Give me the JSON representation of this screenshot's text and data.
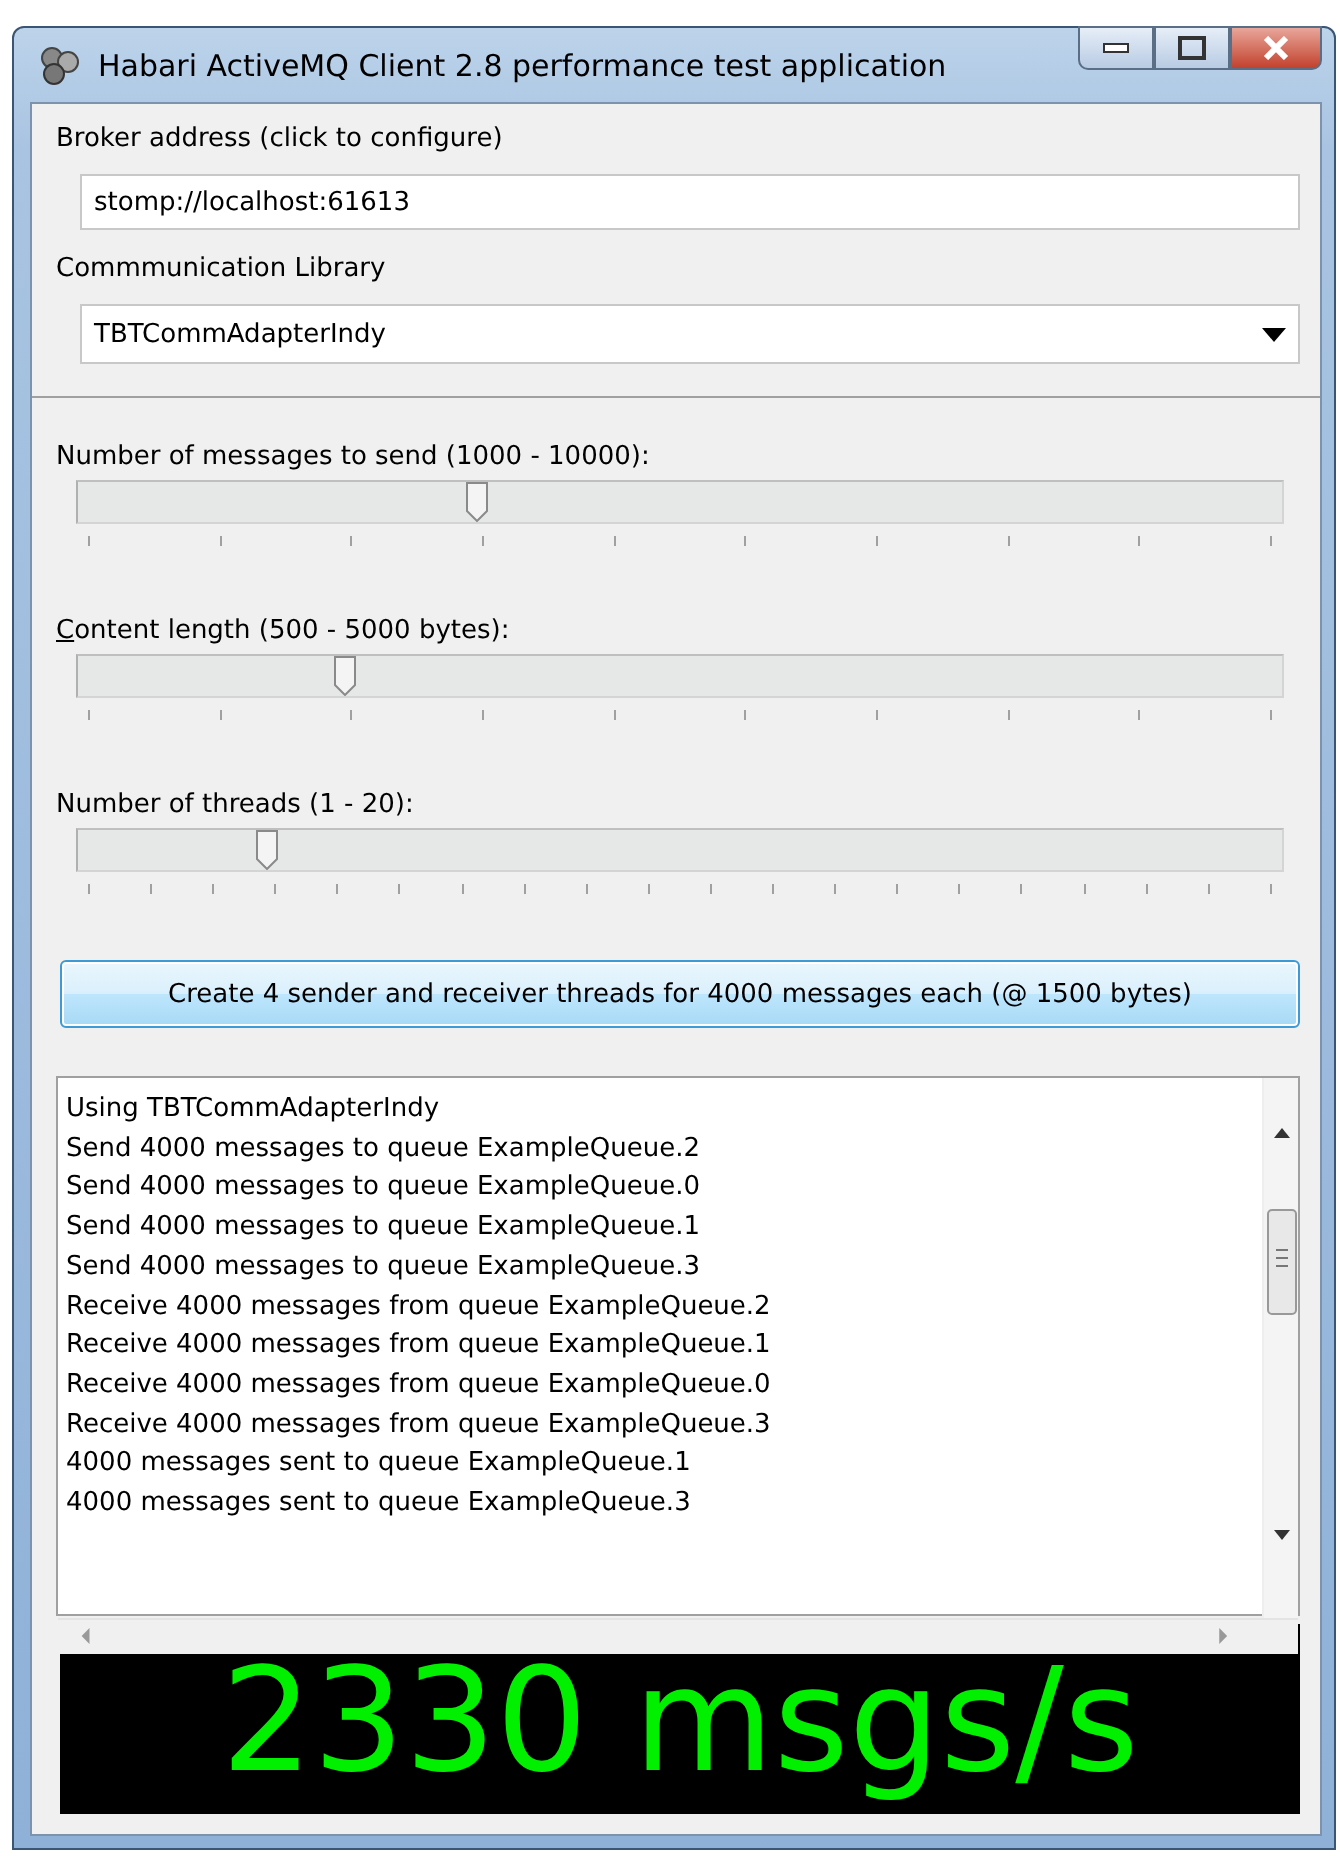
{
  "window": {
    "title": "Habari ActiveMQ Client 2.8 performance test application"
  },
  "broker": {
    "label": "Broker address (click to configure)",
    "value": "stomp://localhost:61613"
  },
  "library": {
    "label": "Commmunication Library",
    "value": "TBTCommAdapterIndy"
  },
  "sliders": [
    {
      "label": "Number of messages to send (1000 - 10000):",
      "mnemonic": false,
      "level": 0.333
    },
    {
      "label": "Content length (500 - 5000 bytes):",
      "mnemonic": true,
      "level": 0.222
    },
    {
      "label": "Number of threads (1 - 20):",
      "mnemonic": false,
      "level": 0.158
    }
  ],
  "start_button": "Create 4 sender and receiver threads for 4000 messages each (@ 1500 bytes)",
  "log": [
    "Using TBTCommAdapterIndy",
    "Send 4000 messages to queue ExampleQueue.2",
    "Send 4000 messages to queue ExampleQueue.0",
    "Send 4000 messages to queue ExampleQueue.1",
    "Send 4000 messages to queue ExampleQueue.3",
    "Receive 4000 messages from queue ExampleQueue.2",
    "Receive 4000 messages from queue ExampleQueue.1",
    "Receive 4000 messages from queue ExampleQueue.0",
    "Receive 4000 messages from queue ExampleQueue.3",
    "4000 messages sent to queue ExampleQueue.1",
    "4000 messages sent to queue ExampleQueue.3"
  ],
  "rate_display": "2330 msgs/s"
}
